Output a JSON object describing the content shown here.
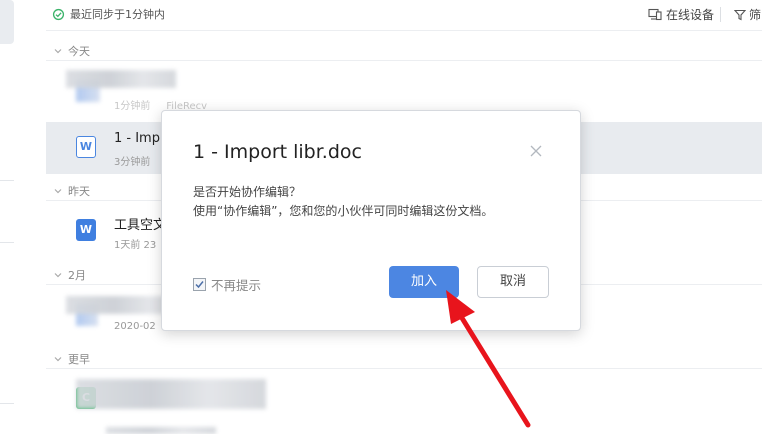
{
  "topbar": {
    "sync_status": "最近同步于1分钟内",
    "online_devices": "在线设备",
    "filter_label": "筛"
  },
  "sections": {
    "today": "今天",
    "yesterday": "昨天",
    "february": "2月",
    "earlier": "更早"
  },
  "files": {
    "row1": {
      "meta_time": "1分钟前",
      "meta_source": "FileRecv"
    },
    "row2": {
      "name": "1 - Imp",
      "meta": "3分钟前"
    },
    "row3": {
      "name": "工具空文",
      "meta": "1天前 23"
    },
    "row4": {
      "meta": "2020-02"
    },
    "row5": {
      "name": ""
    }
  },
  "dialog": {
    "title": "1 - Import libr.doc",
    "body_line1": "是否开始协作编辑？",
    "body_line2": "使用“协作编辑”，您和您的小伙伴可同时编辑这份文档。",
    "dont_remind": "不再提示",
    "join_label": "加入",
    "cancel_label": "取消",
    "dont_remind_checked": true
  },
  "colors": {
    "accent": "#4c86e2",
    "arrow": "#e8141c"
  },
  "icons": [
    "sync-icon",
    "device-icon",
    "filter-icon",
    "chevron-down-icon",
    "word-file-icon",
    "close-icon",
    "checkbox-icon"
  ]
}
